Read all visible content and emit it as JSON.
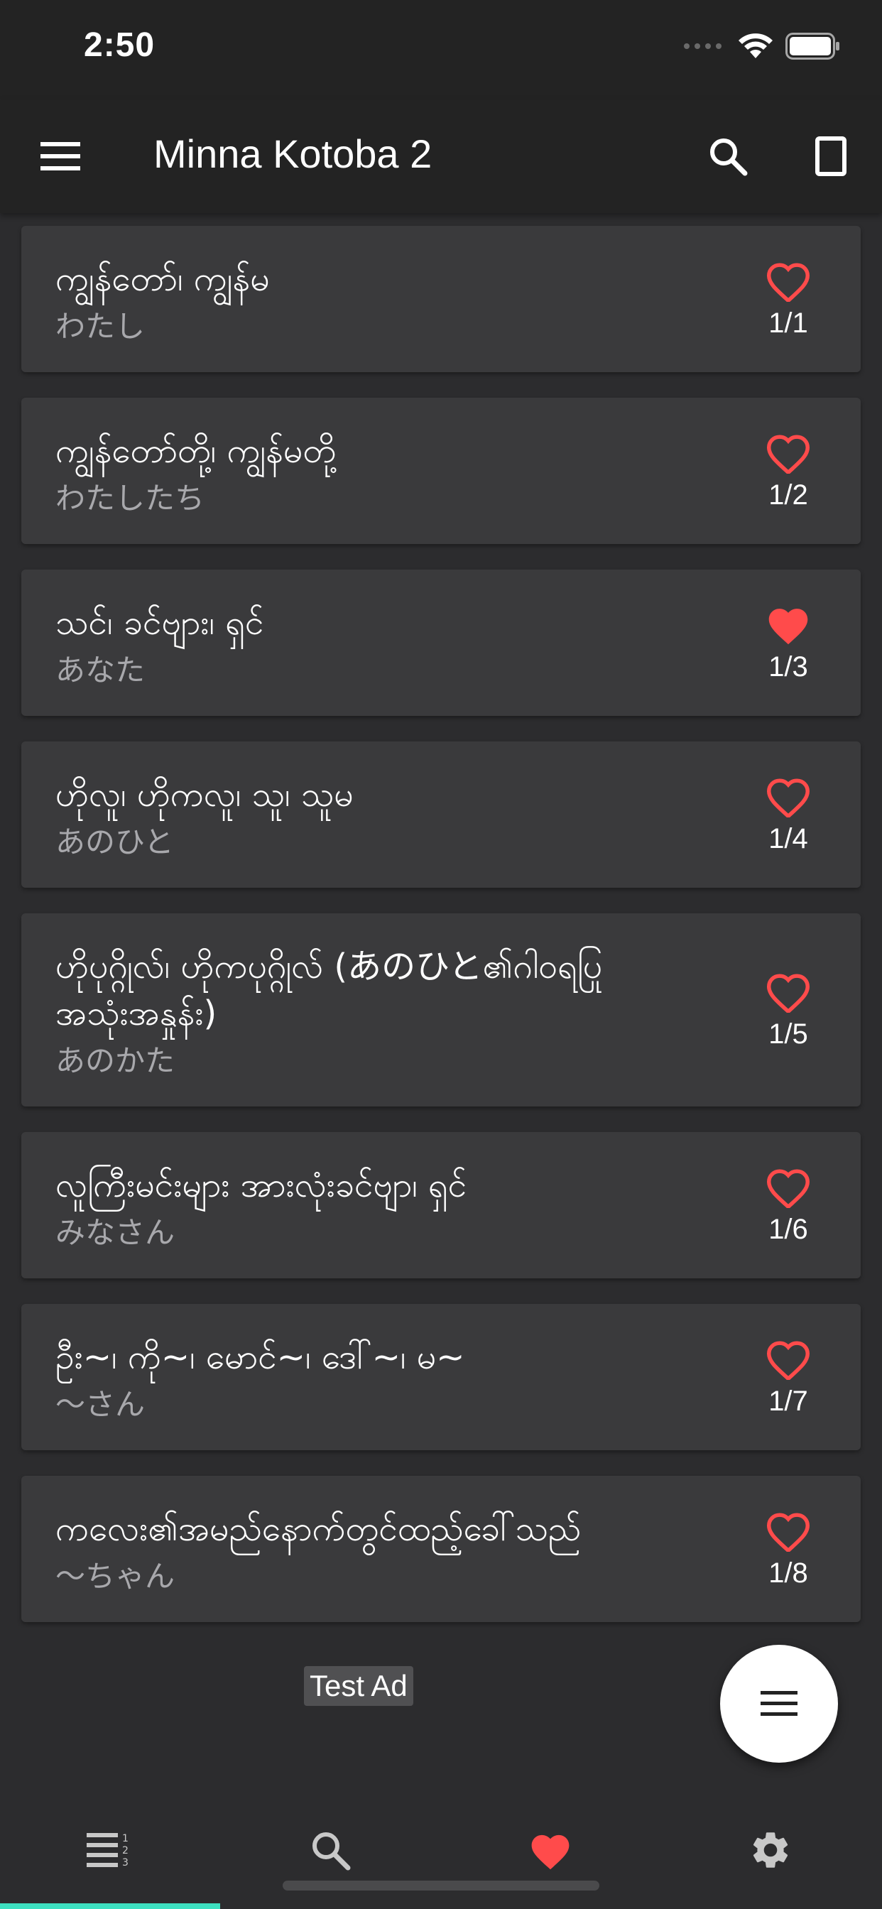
{
  "status_bar": {
    "time": "2:50"
  },
  "app_bar": {
    "title": "Minna Kotoba 2"
  },
  "words": [
    {
      "mm": "ကျွန်တော်၊ ကျွန်မ",
      "jp": "わたし",
      "index": "1/1",
      "favorite": false
    },
    {
      "mm": "ကျွန်တော်တို့၊ ကျွန်မတို့",
      "jp": "わたしたち",
      "index": "1/2",
      "favorite": false
    },
    {
      "mm": "သင်၊ ခင်ဗျား၊ ရှင်",
      "jp": "あなた",
      "index": "1/3",
      "favorite": true
    },
    {
      "mm": "ဟိုလူ၊ ဟိုကလူ၊ သူ၊ သူမ",
      "jp": "あのひと",
      "index": "1/4",
      "favorite": false
    },
    {
      "mm": "ဟိုပုဂ္ဂိုလ်၊ ဟိုကပုဂ္ဂိုလ် (あのひと၏ဂါ၀ရပြု အသုံးအနှုန်း)",
      "jp": "あのかた",
      "index": "1/5",
      "favorite": false
    },
    {
      "mm": "လူကြီးမင်းများ အားလုံးခင်ဗျာ၊ ရှင်",
      "jp": "みなさん",
      "index": "1/6",
      "favorite": false
    },
    {
      "mm": "ဦး~၊ ကို~၊ မောင်~၊ ဒေါ်~၊ မ~",
      "jp": "～さん",
      "index": "1/7",
      "favorite": false
    },
    {
      "mm": "ကလေး၏အမည်နောက်တွင်ထည့်ခေါ်သည်",
      "jp": "～ちゃん",
      "index": "1/8",
      "favorite": false
    }
  ],
  "ad": {
    "label": "Test Ad"
  },
  "colors": {
    "heart": "#ff4b4b",
    "accent": "#3de0c0"
  }
}
